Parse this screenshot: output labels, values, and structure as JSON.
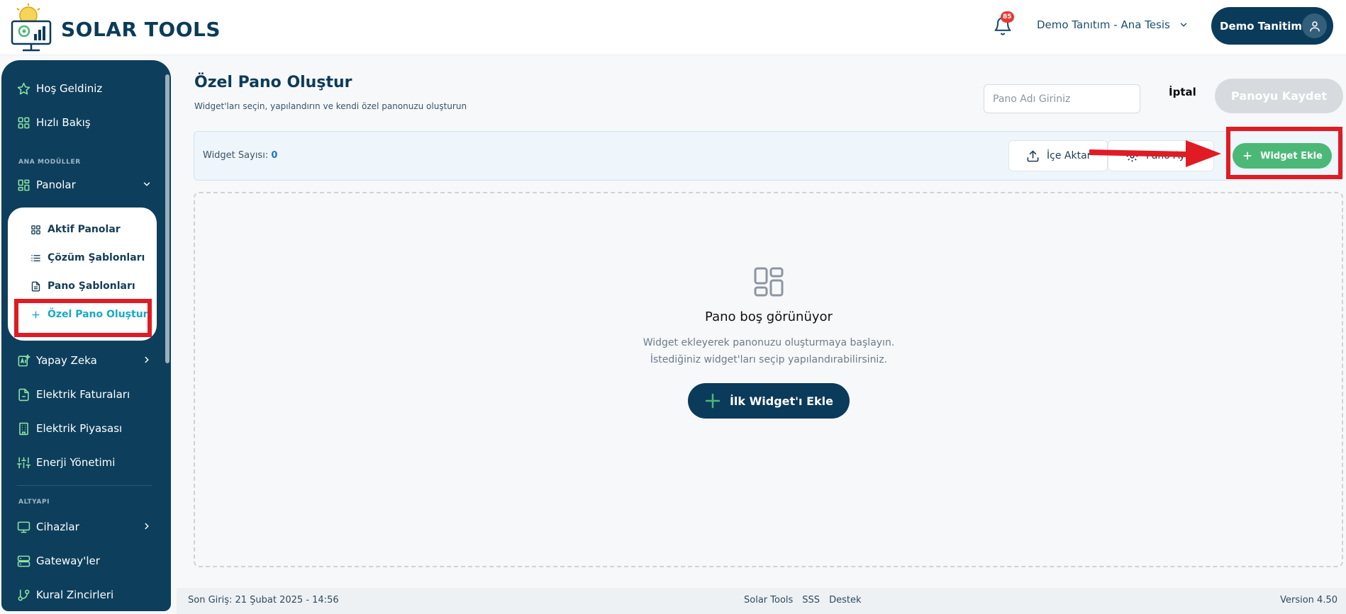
{
  "header": {
    "brand": "SOLAR TOOLS",
    "notification_count": "85",
    "facility": "Demo Tanıtım - Ana Tesis",
    "user_name": "Demo Tanitim"
  },
  "sidebar": {
    "items_top": [
      "Hoş Geldiniz",
      "Hızlı Bakış"
    ],
    "section_main": "ANA MODÜLLER",
    "panolar": "Panolar",
    "submenu": [
      "Aktif Panolar",
      "Çözüm Şablonları",
      "Pano Şablonları",
      "Özel Pano Oluştur"
    ],
    "items_mid": [
      "Yapay Zeka",
      "Elektrik Faturaları",
      "Elektrik Piyasası",
      "Enerji Yönetimi"
    ],
    "section_infra": "ALTYAPI",
    "items_bottom": [
      "Cihazlar",
      "Gateway'ler",
      "Kural Zincirleri"
    ]
  },
  "main": {
    "title": "Özel Pano Oluştur",
    "subtitle": "Widget'ları seçin, yapılandırın ve kendi özel panonuzu oluşturun",
    "name_placeholder": "Pano Adı Giriniz",
    "cancel": "İptal",
    "save": "Panoyu Kaydet",
    "widget_count_label": "Widget Sayısı:",
    "widget_count_value": "0",
    "import_label": "İçe Aktar",
    "settings_label": "Pano Ay",
    "add_widget": "Widget Ekle",
    "empty_title": "Pano boş görünüyor",
    "empty_line1": "Widget ekleyerek panonuzu oluşturmaya başlayın.",
    "empty_line2": "İstediğiniz widget'ları seçip yapılandırabilirsiniz.",
    "first_widget": "İlk Widget'ı Ekle"
  },
  "footer": {
    "last_login": "Son Giriş: 21 Şubat 2025 - 14:56",
    "links": [
      "Solar Tools",
      "SSS",
      "Destek"
    ],
    "version": "Version 4.50"
  },
  "colors": {
    "primary": "#0b3b5a",
    "accent_green": "#4cb877",
    "highlight_red": "#e01b24",
    "active_submenu": "#19a9c9"
  }
}
